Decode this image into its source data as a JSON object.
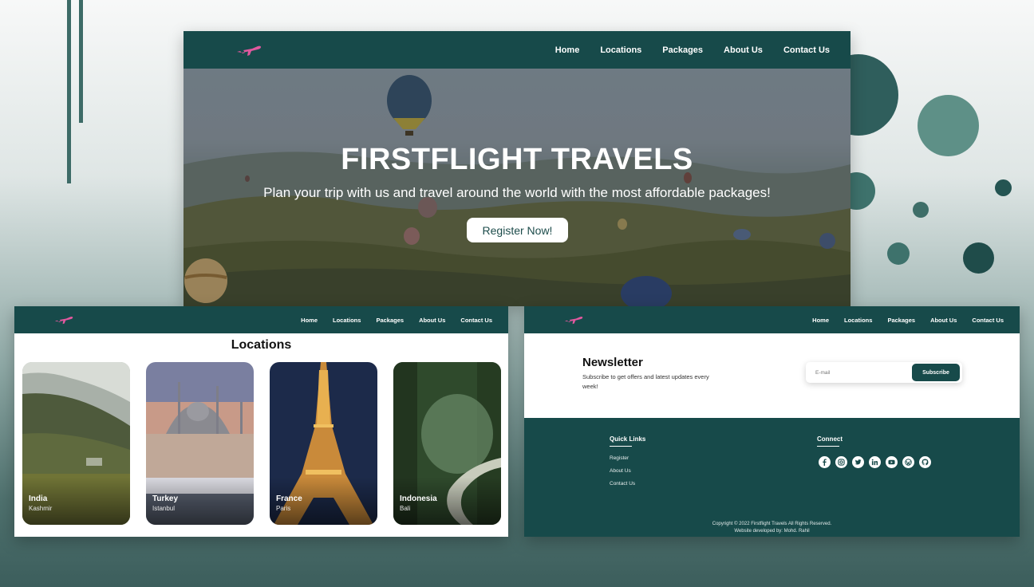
{
  "brand": {
    "logo_icon": "airplane-icon",
    "accent": "#e1589e",
    "primary": "#174a4a"
  },
  "nav": {
    "items": [
      {
        "label": "Home"
      },
      {
        "label": "Locations"
      },
      {
        "label": "Packages"
      },
      {
        "label": "About Us"
      },
      {
        "label": "Contact Us"
      }
    ]
  },
  "hero": {
    "title": "FIRSTFLIGHT TRAVELS",
    "subtitle": "Plan your trip with us and travel around the world with the most affordable packages!",
    "cta_label": "Register Now!"
  },
  "locations": {
    "title": "Locations",
    "cards": [
      {
        "country": "India",
        "city": "Kashmir"
      },
      {
        "country": "Turkey",
        "city": "Istanbul"
      },
      {
        "country": "France",
        "city": "Paris"
      },
      {
        "country": "Indonesia",
        "city": "Bali"
      }
    ]
  },
  "newsletter": {
    "title": "Newsletter",
    "text": "Subscribe to get offers and latest updates every week!",
    "email_placeholder": "E-mail",
    "subscribe_label": "Subscribe"
  },
  "footer": {
    "quick_links_title": "Quick Links",
    "quick_links": [
      {
        "label": "Register"
      },
      {
        "label": "About Us"
      },
      {
        "label": "Contact Us"
      }
    ],
    "connect_title": "Connect",
    "social_icons": [
      "facebook-icon",
      "instagram-icon",
      "twitter-icon",
      "linkedin-icon",
      "youtube-icon",
      "wordpress-icon",
      "github-icon"
    ],
    "copyright": "Copyright © 2022 Firstflight Travels All Rights Reserved.",
    "developer": "Website developed by: Mohd. Rahil"
  }
}
